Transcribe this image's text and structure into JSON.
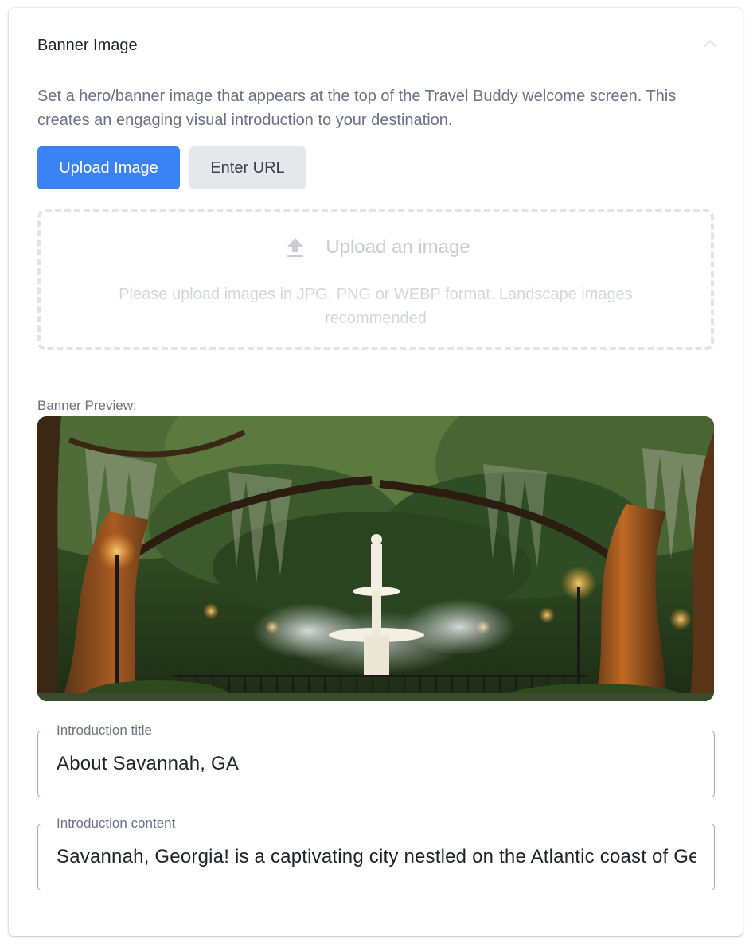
{
  "section": {
    "title": "Banner Image",
    "description": "Set a hero/banner image that appears at the top of the Travel Buddy welcome screen. This creates an engaging visual introduction to your destination."
  },
  "buttons": {
    "upload_label": "Upload Image",
    "url_label": "Enter URL"
  },
  "dropzone": {
    "title": "Upload an image",
    "hint": "Please upload images in JPG, PNG or WEBP format. Landscape images recommended"
  },
  "preview": {
    "label": "Banner Preview:"
  },
  "fields": {
    "intro_title": {
      "label": "Introduction title",
      "value": "About Savannah, GA"
    },
    "intro_content": {
      "label": "Introduction content",
      "value": "Savannah, Georgia! is a captivating city nestled on the Atlantic coast of Georgia"
    }
  },
  "colors": {
    "accent": "#3b82f6",
    "secondary_button": "#e5e7eb",
    "muted_text": "#6b7280"
  },
  "icons": {
    "collapse": "chevron-up-icon",
    "upload": "upload-icon"
  }
}
